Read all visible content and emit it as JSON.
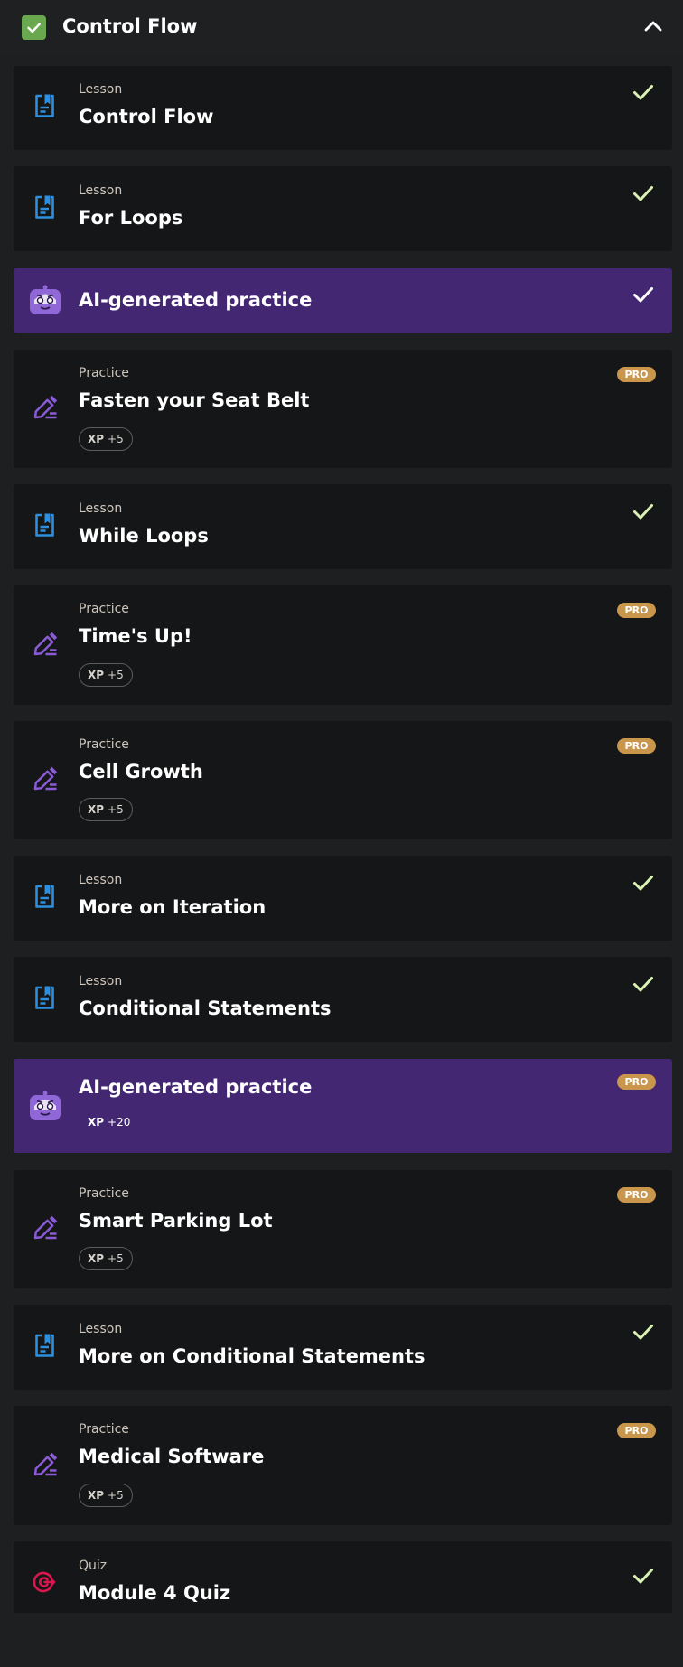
{
  "module": {
    "title": "Control Flow",
    "completed": true,
    "icons": {
      "status": "checkbox-checked-icon",
      "toggle": "chevron-up-icon"
    }
  },
  "colors": {
    "background": "#1e1f21",
    "card": "#151617",
    "ai_card": "#432773",
    "check": "#d9f2b3",
    "pro": "#c9964c",
    "lesson_icon": "#2d8fdd",
    "practice_icon": "#8b5ad6",
    "quiz_icon": "#d9164f"
  },
  "items": [
    {
      "kind": "lesson",
      "type_label": "Lesson",
      "title": "Control Flow",
      "status": "completed",
      "icon": "lesson-document-icon"
    },
    {
      "kind": "lesson",
      "type_label": "Lesson",
      "title": "For Loops",
      "status": "completed",
      "icon": "lesson-document-icon"
    },
    {
      "kind": "ai",
      "title": "AI-generated practice",
      "status": "completed",
      "icon": "ai-robot-icon"
    },
    {
      "kind": "practice",
      "type_label": "Practice",
      "title": "Fasten your Seat Belt",
      "badge": "PRO",
      "xp_label": "XP",
      "xp_value": "+5",
      "icon": "practice-pencil-icon"
    },
    {
      "kind": "lesson",
      "type_label": "Lesson",
      "title": "While Loops",
      "status": "completed",
      "icon": "lesson-document-icon"
    },
    {
      "kind": "practice",
      "type_label": "Practice",
      "title": "Time's Up!",
      "badge": "PRO",
      "xp_label": "XP",
      "xp_value": "+5",
      "icon": "practice-pencil-icon"
    },
    {
      "kind": "practice",
      "type_label": "Practice",
      "title": "Cell Growth",
      "badge": "PRO",
      "xp_label": "XP",
      "xp_value": "+5",
      "icon": "practice-pencil-icon"
    },
    {
      "kind": "lesson",
      "type_label": "Lesson",
      "title": "More on Iteration",
      "status": "completed",
      "icon": "lesson-document-icon"
    },
    {
      "kind": "lesson",
      "type_label": "Lesson",
      "title": "Conditional Statements",
      "status": "completed",
      "icon": "lesson-document-icon"
    },
    {
      "kind": "ai",
      "title": "AI-generated practice",
      "badge": "PRO",
      "xp_label": "XP",
      "xp_value": "+20",
      "icon": "ai-robot-icon"
    },
    {
      "kind": "practice",
      "type_label": "Practice",
      "title": "Smart Parking Lot",
      "badge": "PRO",
      "xp_label": "XP",
      "xp_value": "+5",
      "icon": "practice-pencil-icon"
    },
    {
      "kind": "lesson",
      "type_label": "Lesson",
      "title": "More on Conditional Statements",
      "status": "completed",
      "icon": "lesson-document-icon"
    },
    {
      "kind": "practice",
      "type_label": "Practice",
      "title": "Medical Software",
      "badge": "PRO",
      "xp_label": "XP",
      "xp_value": "+5",
      "icon": "practice-pencil-icon"
    },
    {
      "kind": "quiz",
      "type_label": "Quiz",
      "title": "Module 4 Quiz",
      "status": "completed",
      "icon": "quiz-target-icon"
    }
  ]
}
